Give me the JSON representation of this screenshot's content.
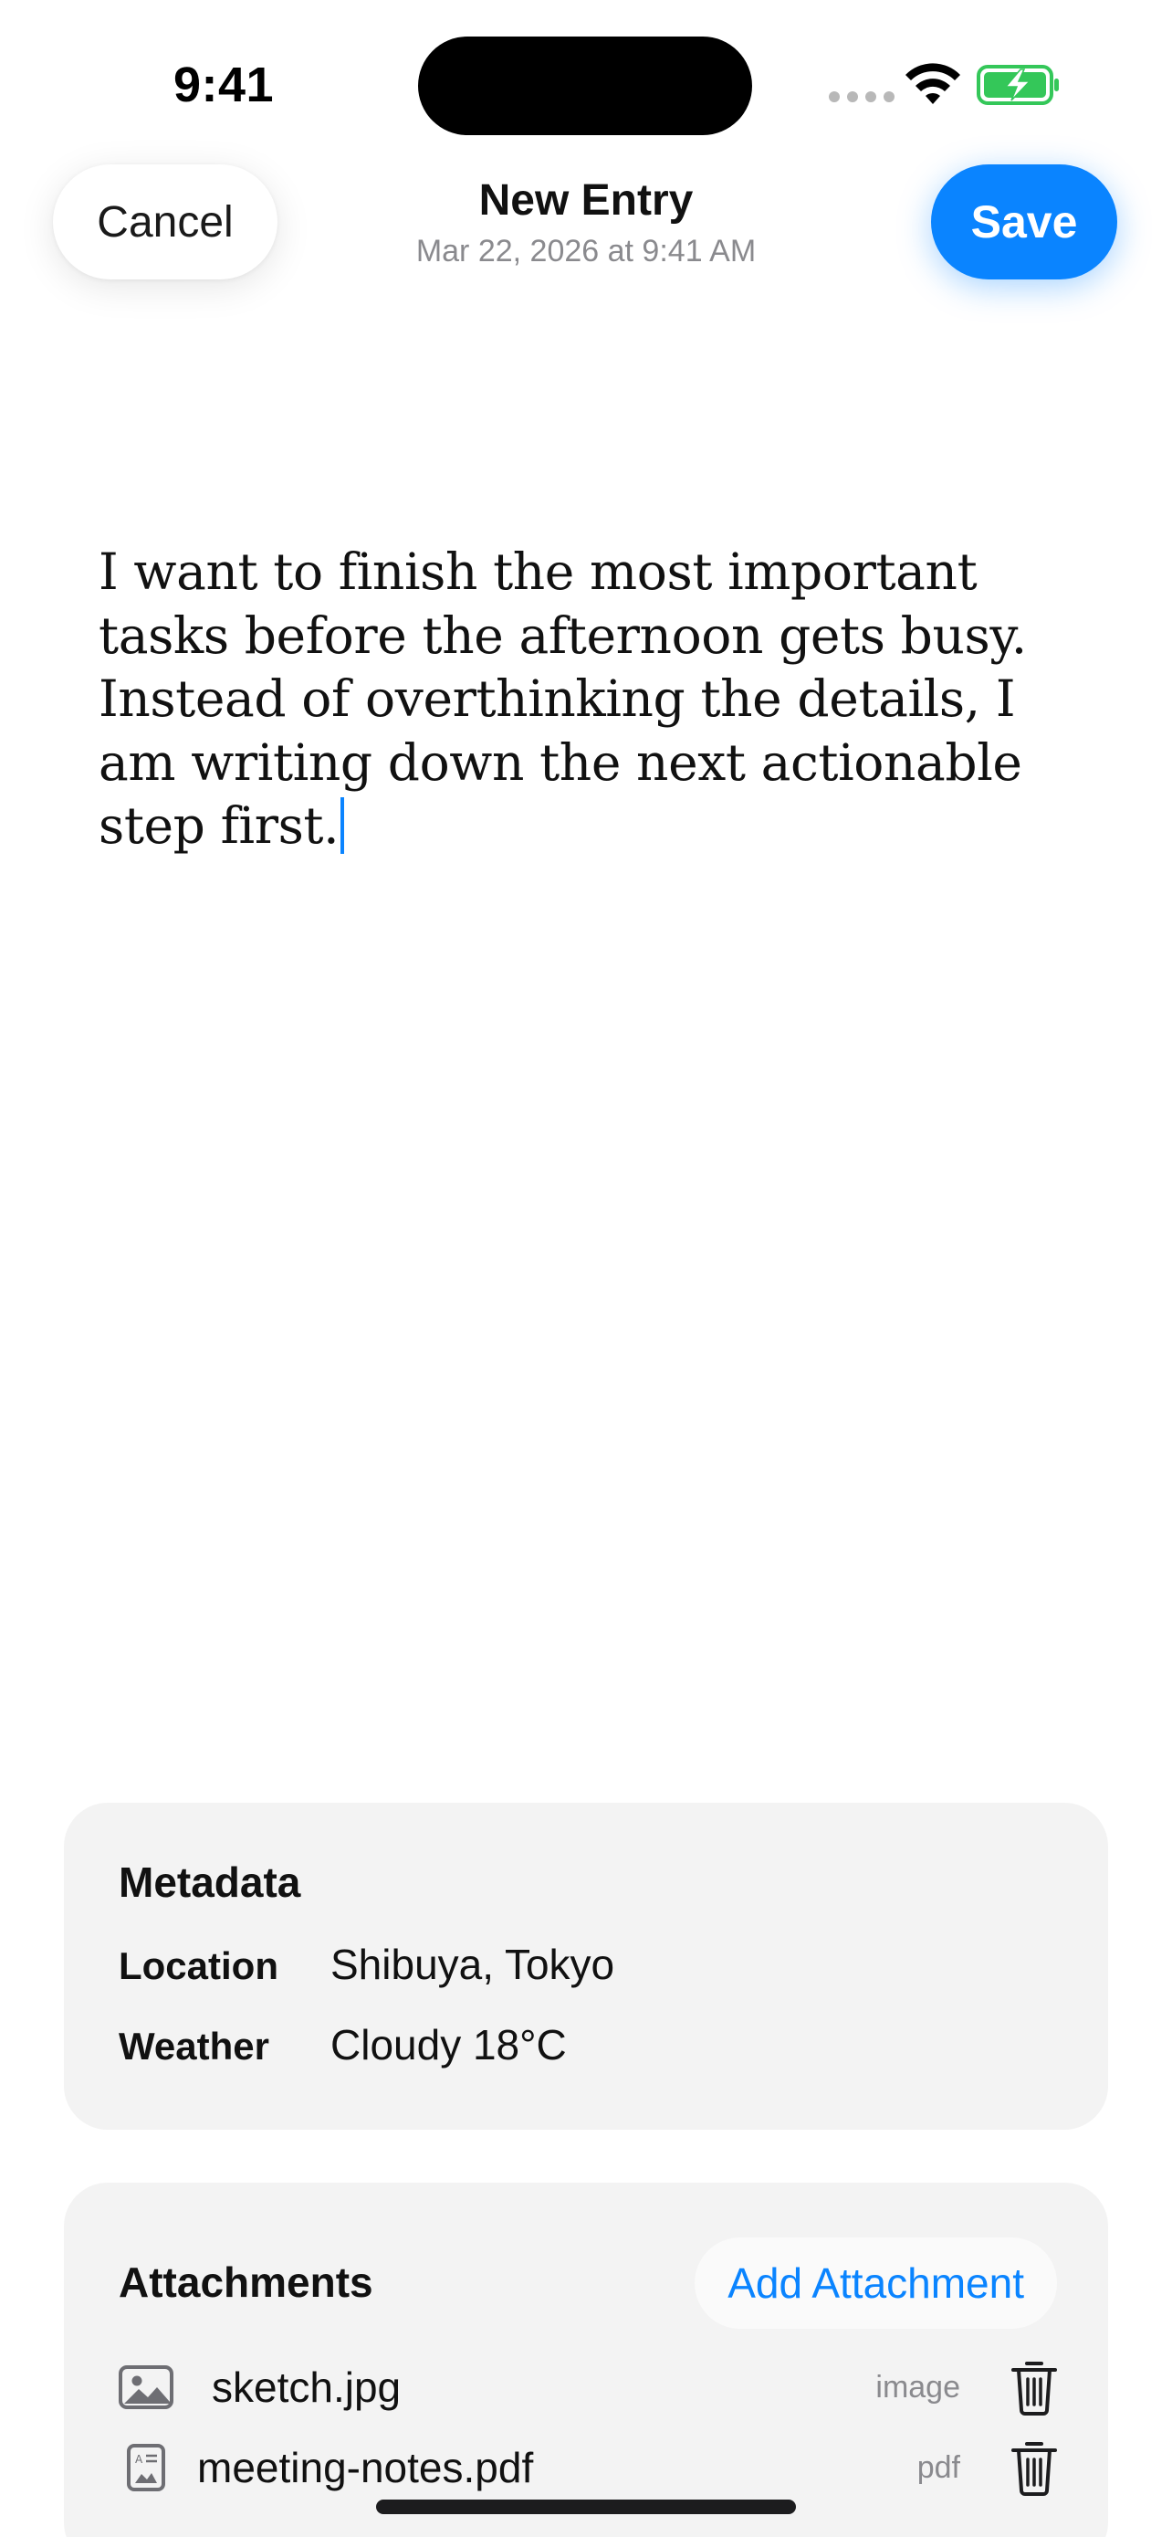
{
  "status_bar": {
    "time": "9:41",
    "icons": [
      "signal-icon",
      "wifi-icon",
      "battery-charging-icon"
    ],
    "battery_color": "#34c759"
  },
  "nav": {
    "cancel_label": "Cancel",
    "save_label": "Save",
    "title": "New Entry",
    "subtitle": "Mar 22, 2026 at 9:41 AM"
  },
  "entry": {
    "text": "I want to finish the most important tasks before the afternoon gets busy. Instead of overthinking the details, I am writing down the next actionable step first."
  },
  "metadata": {
    "title": "Metadata",
    "rows": [
      {
        "label": "Location",
        "value": "Shibuya, Tokyo"
      },
      {
        "label": "Weather",
        "value": "Cloudy 18°C"
      }
    ]
  },
  "attachments": {
    "title": "Attachments",
    "add_label": "Add Attachment",
    "items": [
      {
        "name": "sketch.jpg",
        "type": "image",
        "icon": "image-icon"
      },
      {
        "name": "meeting-notes.pdf",
        "type": "pdf",
        "icon": "document-icon"
      }
    ]
  },
  "colors": {
    "accent": "#0a84ff",
    "card_background": "#f3f3f3",
    "secondary_text": "#8a8a8e"
  }
}
